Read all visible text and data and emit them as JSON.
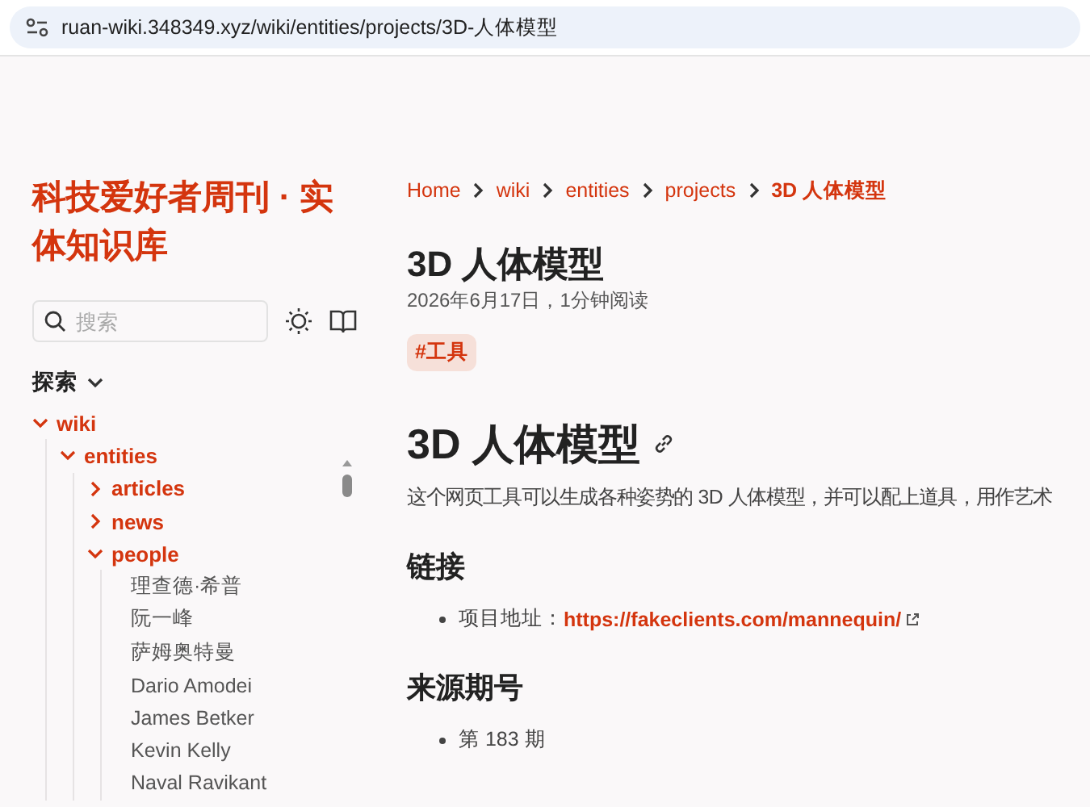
{
  "address_bar": {
    "url": "ruan-wiki.348349.xyz/wiki/entities/projects/3D-人体模型"
  },
  "sidebar": {
    "site_title": "科技爱好者周刊 · 实体知识库",
    "search": {
      "placeholder": "搜索"
    },
    "explore": {
      "label": "探索",
      "expanded": true
    },
    "tree": [
      {
        "label": "wiki",
        "expanded": true,
        "children": [
          {
            "label": "entities",
            "expanded": true,
            "children": [
              {
                "label": "articles",
                "expanded": false
              },
              {
                "label": "news",
                "expanded": false
              },
              {
                "label": "people",
                "expanded": true,
                "children": [
                  {
                    "label": "理查德·希普"
                  },
                  {
                    "label": "阮一峰"
                  },
                  {
                    "label": "萨姆奥特曼"
                  },
                  {
                    "label": "Dario Amodei"
                  },
                  {
                    "label": "James Betker"
                  },
                  {
                    "label": "Kevin Kelly"
                  },
                  {
                    "label": "Naval Ravikant"
                  }
                ]
              }
            ]
          }
        ]
      }
    ]
  },
  "breadcrumb": [
    "Home",
    "wiki",
    "entities",
    "projects",
    "3D 人体模型"
  ],
  "article": {
    "title": "3D 人体模型",
    "meta": "2026年6月17日，1分钟阅读",
    "tags": [
      "#工具"
    ],
    "heading": "3D 人体模型",
    "intro": "这个网页工具可以生成各种姿势的 3D 人体模型，并可以配上道具，用作艺术",
    "sections": [
      {
        "heading": "链接",
        "items": [
          {
            "label": "项目地址：",
            "link": "https://fakeclients.com/mannequin/"
          }
        ]
      },
      {
        "heading": "来源期号",
        "items": [
          {
            "label": "第 183 期"
          }
        ]
      }
    ]
  }
}
